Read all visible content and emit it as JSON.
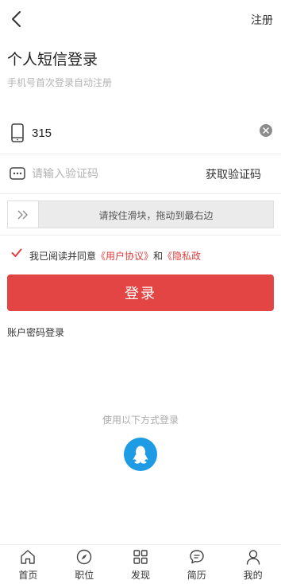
{
  "header": {
    "register_label": "注册"
  },
  "title": "个人短信登录",
  "subtitle": "手机号首次登录自动注册",
  "phone": {
    "value": "315"
  },
  "code": {
    "placeholder": "请输入验证码",
    "get_code_label": "获取验证码"
  },
  "slider": {
    "text": "请按住滑块，拖动到最右边"
  },
  "agreement": {
    "checked": true,
    "prefix": "我已阅读并同意",
    "user_agreement": "《用户协议》",
    "and": "和",
    "privacy": "《隐私政"
  },
  "login_button": "登录",
  "password_login": "账户密码登录",
  "other_methods": "使用以下方式登录",
  "colors": {
    "accent": "#e34444",
    "link": "#e33d3d",
    "qq": "#1d9be4"
  },
  "tabs": [
    {
      "label": "首页",
      "icon": "home-icon"
    },
    {
      "label": "职位",
      "icon": "compass-icon"
    },
    {
      "label": "发现",
      "icon": "grid-icon"
    },
    {
      "label": "简历",
      "icon": "chat-icon"
    },
    {
      "label": "我的",
      "icon": "user-icon"
    }
  ]
}
